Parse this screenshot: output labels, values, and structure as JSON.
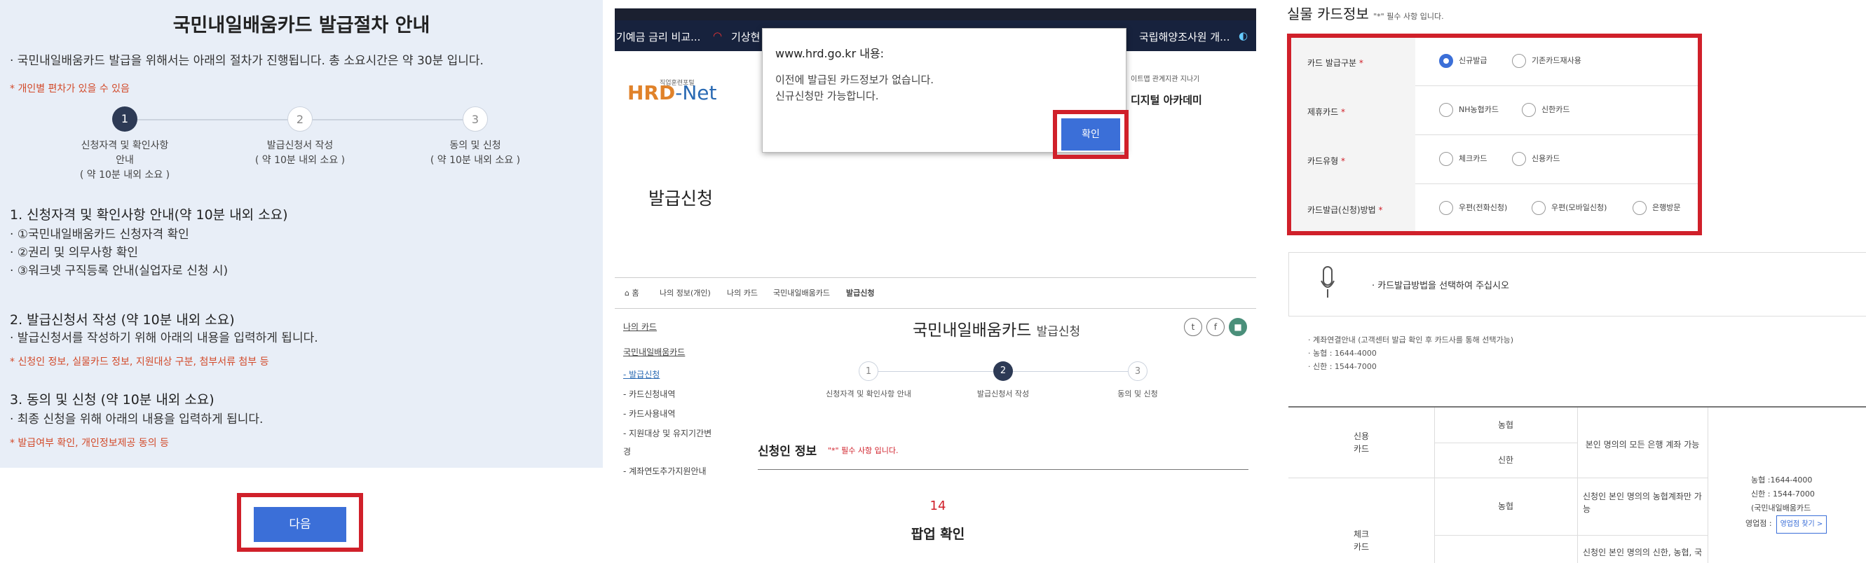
{
  "left": {
    "title": "국민내일배움카드 발급절차 안내",
    "intro": "· 국민내일배움카드 발급을 위해서는 아래의 절차가 진행됩니다. 총 소요시간은 약 30분 입니다.",
    "note": "* 개인별 편차가 있을 수 있음",
    "steps": [
      {
        "num": "1",
        "label_lines": [
          "신청자격 및 확인사항",
          "안내",
          "( 약 10분 내외 소요 )"
        ]
      },
      {
        "num": "2",
        "label_lines": [
          "발급신청서 작성",
          "( 약 10분 내외 소요 )"
        ]
      },
      {
        "num": "3",
        "label_lines": [
          "동의 및 신청",
          "( 약 10분 내외 소요 )"
        ]
      }
    ],
    "sec1": {
      "heading": "1. 신청자격 및 확인사항 안내(약 10분 내외 소요)",
      "items": [
        "· ①국민내일배움카드 신청자격 확인",
        "· ②권리 및 의무사항 확인",
        "· ③워크넷 구직등록 안내(실업자로 신청 시)"
      ]
    },
    "sec2": {
      "heading": "2. 발급신청서 작성 (약 10분 내외 소요)",
      "items": [
        "· 발급신청서를 작성하기 위해 아래의 내용을 입력하게 됩니다."
      ],
      "note": "* 신청인 정보, 실물카드 정보, 지원대상 구분, 첨부서류 첨부 등"
    },
    "sec3": {
      "heading": "3. 동의 및 신청 (약 10분 내외 소요)",
      "items": [
        "· 최종 신청을 위해 아래의 내용을 입력하게 됩니다."
      ],
      "note": "* 발급여부 확인, 개인정보제공 동의 등"
    },
    "next_button": "다음"
  },
  "middle": {
    "ticker": [
      "기예금 금리 비교...",
      "기상현",
      "국립해양조사원 개..."
    ],
    "logo_sub": "직업훈련포털",
    "logo_hrd": "HRD",
    "logo_net": "-Net",
    "header_links": "이트맵 관계지관  지나기",
    "digital_academy": "디지털 아카데미",
    "page_title": "발급신청",
    "breadcrumb": [
      "⌂ 홈",
      "나의 정보(개인)",
      "나의 카드",
      "국민내일배움카드",
      "발급신청"
    ],
    "side_menu": [
      "나의 카드",
      "국민내일배움카드",
      "- 발급신청",
      "- 카드신청내역",
      "- 카드사용내역",
      "- 지원대상 및 유지기간변",
      "경",
      "- 계좌연도추가지원안내"
    ],
    "main_title": "국민내일배움카드",
    "main_title_sub": "발급신청",
    "sns": [
      "t",
      "f",
      "■"
    ],
    "mini_steps": [
      {
        "num": "1",
        "label": "신청자격 및 확인사항 안내"
      },
      {
        "num": "2",
        "label": "발급신청서 작성"
      },
      {
        "num": "3",
        "label": "동의 및 신청"
      }
    ],
    "applicant_heading": "신청인 정보",
    "applicant_note": "\"*\" 필수 사항 입니다.",
    "dialog": {
      "title": "www.hrd.go.kr 내용:",
      "lines": [
        "이전에 발급된 카드정보가 없습니다.",
        "신규신청만 가능합니다."
      ],
      "ok": "확인"
    },
    "caption_number": "14",
    "caption_text": "팝업 확인"
  },
  "right": {
    "title": "실물 카드정보",
    "title_note": "\"*\" 필수 사항 입니다.",
    "rows": [
      {
        "label": "카드 발급구분",
        "options": [
          "신규발급",
          "기존카드재사용"
        ],
        "selected": 0
      },
      {
        "label": "제휴카드",
        "options": [
          "NH농협카드",
          "신한카드"
        ],
        "selected": -1
      },
      {
        "label": "카드유형",
        "options": [
          "체크카드",
          "신용카드"
        ],
        "selected": -1
      },
      {
        "label": "카드발급(신청)방법",
        "options": [
          "우편(전화신청)",
          "우편(모바일신청)",
          "은행방문"
        ],
        "selected": -1
      }
    ],
    "mic_text": "· 카드발급방법을 선택하여 주십시오",
    "notes": [
      "· 계좌연결안내 (고객센터 발급 확인 후 카드사를 통해 선택가능)",
      "· 농협 : 1644-4000",
      "· 신한 : 1544-7000"
    ],
    "table": {
      "credit": "신용\n카드",
      "check": "체크\n카드",
      "nh": "농협",
      "sh": "신한",
      "nh2": "농협",
      "credit_desc": "본인 명의의 모든 은행 계좌 가능",
      "check_desc1": "신청인 본인 명의의 농협계좌만 가능",
      "check_desc2": "신청인 본인 명의의 신한, 농협, 국",
      "contact": [
        "농협 :1644-4000",
        "신한 : 1544-7000",
        "(국민내일배움카드",
        "영업점 :"
      ],
      "more": "영업점 찾기 >"
    }
  }
}
